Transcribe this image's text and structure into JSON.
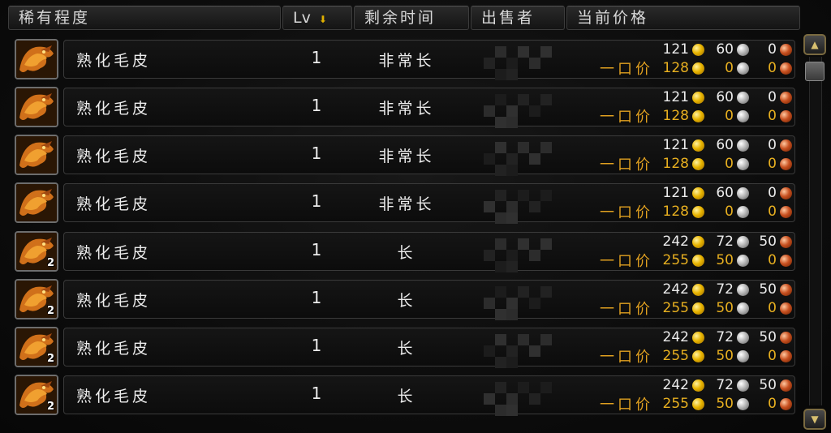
{
  "columns": {
    "rarity": "稀有程度",
    "level": "Lv",
    "time_left": "剩余时间",
    "seller": "出售者",
    "current_price": "当前价格"
  },
  "buyout_label": "一口价",
  "colors": {
    "gold_text": "#e8b020",
    "text": "#ececec",
    "border": "#3a3a3a"
  },
  "rows": [
    {
      "name": "熟化毛皮",
      "level": "1",
      "time_left": "非常长",
      "stack": "",
      "bid": {
        "g": "121",
        "s": "60",
        "c": "0"
      },
      "buyout": {
        "g": "128",
        "s": "0",
        "c": "0"
      }
    },
    {
      "name": "熟化毛皮",
      "level": "1",
      "time_left": "非常长",
      "stack": "",
      "bid": {
        "g": "121",
        "s": "60",
        "c": "0"
      },
      "buyout": {
        "g": "128",
        "s": "0",
        "c": "0"
      }
    },
    {
      "name": "熟化毛皮",
      "level": "1",
      "time_left": "非常长",
      "stack": "",
      "bid": {
        "g": "121",
        "s": "60",
        "c": "0"
      },
      "buyout": {
        "g": "128",
        "s": "0",
        "c": "0"
      }
    },
    {
      "name": "熟化毛皮",
      "level": "1",
      "time_left": "非常长",
      "stack": "",
      "bid": {
        "g": "121",
        "s": "60",
        "c": "0"
      },
      "buyout": {
        "g": "128",
        "s": "0",
        "c": "0"
      }
    },
    {
      "name": "熟化毛皮",
      "level": "1",
      "time_left": "长",
      "stack": "2",
      "bid": {
        "g": "242",
        "s": "72",
        "c": "50"
      },
      "buyout": {
        "g": "255",
        "s": "50",
        "c": "0"
      }
    },
    {
      "name": "熟化毛皮",
      "level": "1",
      "time_left": "长",
      "stack": "2",
      "bid": {
        "g": "242",
        "s": "72",
        "c": "50"
      },
      "buyout": {
        "g": "255",
        "s": "50",
        "c": "0"
      }
    },
    {
      "name": "熟化毛皮",
      "level": "1",
      "time_left": "长",
      "stack": "2",
      "bid": {
        "g": "242",
        "s": "72",
        "c": "50"
      },
      "buyout": {
        "g": "255",
        "s": "50",
        "c": "0"
      }
    },
    {
      "name": "熟化毛皮",
      "level": "1",
      "time_left": "长",
      "stack": "2",
      "bid": {
        "g": "242",
        "s": "72",
        "c": "50"
      },
      "buyout": {
        "g": "255",
        "s": "50",
        "c": "0"
      }
    }
  ]
}
